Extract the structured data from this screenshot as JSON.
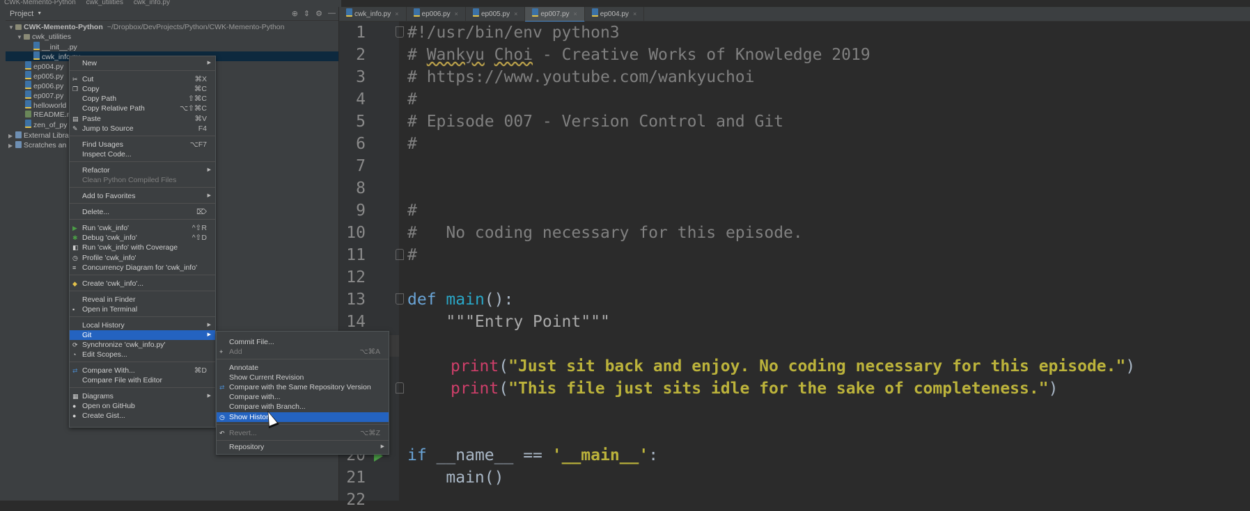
{
  "titlebar": {
    "crumbs": [
      "CWK-Memento-Python",
      "cwk_utilities",
      "cwk_info.py"
    ]
  },
  "project": {
    "header": "Project",
    "tree": [
      {
        "label": "CWK-Memento-Python",
        "path": "~/Dropbox/DevProjects/Python/CWK-Memento-Python",
        "indent": 0,
        "type": "folder",
        "bold": true
      },
      {
        "label": "cwk_utilities",
        "indent": 1,
        "type": "folder"
      },
      {
        "label": "__init__.py",
        "indent": 3,
        "type": "py"
      },
      {
        "label": "cwk_info.py",
        "indent": 3,
        "type": "py",
        "selected": true
      },
      {
        "label": "ep004.py",
        "indent": 2,
        "type": "py"
      },
      {
        "label": "ep005.py",
        "indent": 2,
        "type": "py"
      },
      {
        "label": "ep006.py",
        "indent": 2,
        "type": "py"
      },
      {
        "label": "ep007.py",
        "indent": 2,
        "type": "py"
      },
      {
        "label": "helloworld",
        "indent": 2,
        "type": "py"
      },
      {
        "label": "README.m",
        "indent": 2,
        "type": "md"
      },
      {
        "label": "zen_of_py",
        "indent": 2,
        "type": "py"
      },
      {
        "label": "External Libra",
        "indent": 0,
        "type": "lib"
      },
      {
        "label": "Scratches an",
        "indent": 0,
        "type": "lib"
      }
    ]
  },
  "tabs": [
    {
      "label": "cwk_info.py"
    },
    {
      "label": "ep006.py"
    },
    {
      "label": "ep005.py"
    },
    {
      "label": "ep007.py",
      "active": true
    },
    {
      "label": "ep004.py"
    }
  ],
  "editor": {
    "line_numbers": [
      "1",
      "2",
      "3",
      "4",
      "5",
      "6",
      "7",
      "8",
      "9",
      "10",
      "11",
      "12",
      "13",
      "14",
      "",
      "",
      "",
      "",
      "",
      "20",
      "21",
      "22"
    ],
    "lines": {
      "l1": "#!/usr/bin/env python3",
      "l2a": "# ",
      "l2b": "Wankyu",
      "l2c": " ",
      "l2d": "Choi",
      "l2e": " - Creative Works of Knowledge 2019",
      "l3": "# https://www.youtube.com/wankyuchoi",
      "l4": "#",
      "l5": "# Episode 007 - Version Control and Git",
      "l6": "#",
      "l9": "#",
      "l10": "#   No coding necessary for this episode.",
      "l11": "#",
      "l13a": "def",
      "l13b": "main",
      "l13c": "():",
      "l14": "    \"\"\"Entry Point\"\"\"",
      "l16a": "print",
      "l16b": "(",
      "l16c": "\"Just sit back and enjoy. No coding necessary for this episode.\"",
      "l16d": ")",
      "l17a": "print",
      "l17b": "(",
      "l17c": "\"This file just sits idle for the sake of completeness.\"",
      "l17d": ")",
      "l20a": "if",
      "l20b": " __name__ ",
      "l20c": "==",
      "l20d": " ",
      "l20e": "'__main__'",
      "l20f": ":",
      "l21": "    main()"
    }
  },
  "context_menu": {
    "new": "New",
    "cut": "Cut",
    "cut_sc": "⌘X",
    "copy": "Copy",
    "copy_sc": "⌘C",
    "copy_path": "Copy Path",
    "copy_path_sc": "⇧⌘C",
    "copy_rel": "Copy Relative Path",
    "copy_rel_sc": "⌥⇧⌘C",
    "paste": "Paste",
    "paste_sc": "⌘V",
    "jump": "Jump to Source",
    "jump_sc": "F4",
    "find_usages": "Find Usages",
    "find_usages_sc": "⌥F7",
    "inspect": "Inspect Code...",
    "refactor": "Refactor",
    "clean": "Clean Python Compiled Files",
    "favorites": "Add to Favorites",
    "delete": "Delete...",
    "delete_sc": "⌦",
    "run": "Run 'cwk_info'",
    "run_sc": "^⇧R",
    "debug": "Debug 'cwk_info'",
    "debug_sc": "^⇧D",
    "coverage": "Run 'cwk_info' with Coverage",
    "profile": "Profile 'cwk_info'",
    "concurrency": "Concurrency Diagram for 'cwk_info'",
    "create": "Create 'cwk_info'...",
    "reveal": "Reveal in Finder",
    "terminal": "Open in Terminal",
    "local_history": "Local History",
    "git": "Git",
    "sync": "Synchronize 'cwk_info.py'",
    "scopes": "Edit Scopes...",
    "compare": "Compare With...",
    "compare_sc": "⌘D",
    "compare_editor": "Compare File with Editor",
    "diagrams": "Diagrams",
    "github": "Open on GitHub",
    "gist": "Create Gist..."
  },
  "git_submenu": {
    "commit": "Commit File...",
    "add": "Add",
    "add_sc": "⌥⌘A",
    "annotate": "Annotate",
    "show_rev": "Show Current Revision",
    "compare_same": "Compare with the Same Repository Version",
    "compare_with": "Compare with...",
    "compare_branch": "Compare with Branch...",
    "show_history": "Show History",
    "revert": "Revert...",
    "revert_sc": "⌥⌘Z",
    "repository": "Repository"
  }
}
